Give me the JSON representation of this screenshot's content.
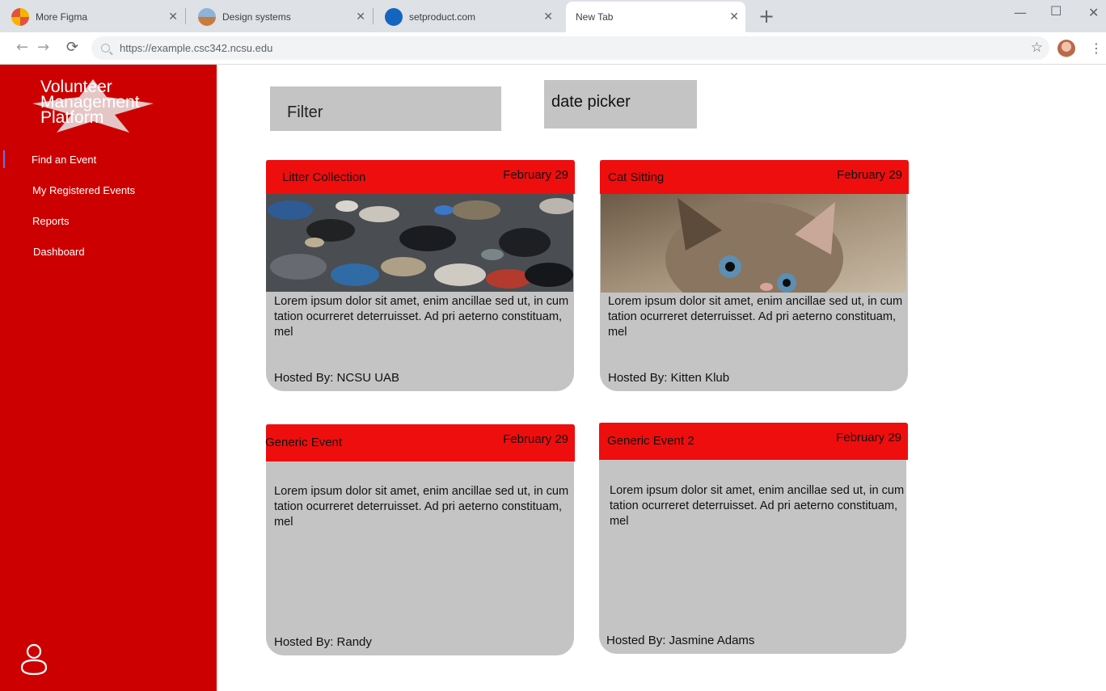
{
  "browser": {
    "tabs": [
      {
        "title": "More Figma",
        "active": false
      },
      {
        "title": "Design systems",
        "active": false
      },
      {
        "title": "setproduct.com",
        "active": false
      },
      {
        "title": "New Tab",
        "active": true
      }
    ],
    "url": "https://example.csc342.ncsu.edu"
  },
  "sidebar": {
    "logo_text": "Volunteer\nManagement\nPlatform",
    "items": [
      {
        "label": "Find an Event",
        "selected": true
      },
      {
        "label": "My Registered Events"
      },
      {
        "label": "Reports"
      },
      {
        "label": "Dashboard"
      }
    ]
  },
  "filters": {
    "filter_label": "Filter",
    "date_label": "date picker"
  },
  "events": [
    {
      "title": "Litter Collection",
      "date": "February 29",
      "description": "Lorem ipsum dolor sit amet, enim ancillae sed ut, in cum tation ocurreret deterruisset. Ad pri aeterno constituam, mel",
      "host": "Hosted By: NCSU UAB",
      "image": "litter-photo"
    },
    {
      "title": "Cat Sitting",
      "date": "February 29",
      "description": "Lorem ipsum dolor sit amet, enim ancillae sed ut, in cum tation ocurreret deterruisset. Ad pri aeterno constituam, mel",
      "host": "Hosted By: Kitten Klub",
      "image": "kitten-photo"
    },
    {
      "title": "Generic Event",
      "date": "February 29",
      "description": "Lorem ipsum dolor sit amet, enim ancillae sed ut, in cum tation ocurreret deterruisset. Ad pri aeterno constituam, mel",
      "host": "Hosted By: Randy"
    },
    {
      "title": "Generic Event 2",
      "date": "February 29",
      "description": "Lorem ipsum dolor sit amet, enim ancillae sed ut, in cum tation ocurreret deterruisset. Ad pri aeterno constituam, mel",
      "host": "Hosted By: Jasmine Adams"
    }
  ],
  "colors": {
    "sidebar": "#cc0000",
    "card_header": "#ee0e0e",
    "card_body": "#c4c4c4"
  }
}
